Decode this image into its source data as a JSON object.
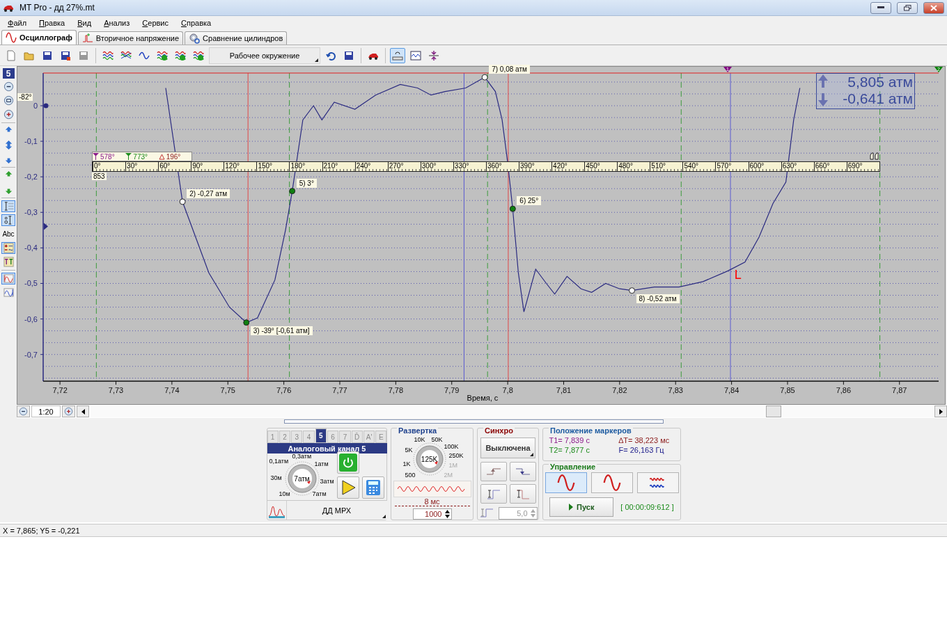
{
  "window": {
    "title": "MT Pro - дд 27%.mt"
  },
  "menu": [
    "Файл",
    "Правка",
    "Вид",
    "Анализ",
    "Сервис",
    "Справка"
  ],
  "tabs": [
    {
      "label": "Осциллограф",
      "selected": true,
      "kind": "sine"
    },
    {
      "label": "Вторичное напряжение",
      "selected": false,
      "kind": "spark"
    },
    {
      "label": "Сравнение цилиндров",
      "selected": false,
      "kind": "gear"
    }
  ],
  "toolbar": {
    "environment": "Рабочее окружение",
    "items": [
      {
        "kind": "new",
        "pressed": false
      },
      {
        "kind": "open",
        "pressed": false
      },
      {
        "kind": "save",
        "pressed": false
      },
      {
        "kind": "save-as",
        "pressed": false
      },
      {
        "kind": "save-copy",
        "pressed": false
      },
      {
        "kind": "sep"
      },
      {
        "kind": "waves-stack",
        "pressed": false
      },
      {
        "kind": "waves-cross",
        "pressed": false
      },
      {
        "kind": "wave-loop",
        "pressed": false
      },
      {
        "kind": "wave-check",
        "pressed": false
      },
      {
        "kind": "wave-one",
        "pressed": false
      },
      {
        "kind": "wave-two",
        "pressed": false
      },
      {
        "kind": "env"
      },
      {
        "kind": "undo",
        "pressed": false
      },
      {
        "kind": "save-screen",
        "pressed": false
      },
      {
        "kind": "sep"
      },
      {
        "kind": "car",
        "pressed": false
      },
      {
        "kind": "sep"
      },
      {
        "kind": "ruler-sync",
        "pressed": true
      },
      {
        "kind": "chart-wave",
        "pressed": false
      },
      {
        "kind": "split",
        "pressed": false
      }
    ]
  },
  "left_tools": [
    {
      "kind": "badge",
      "label": "5"
    },
    {
      "kind": "zoom-out",
      "pressed": false
    },
    {
      "kind": "zoom-fit",
      "pressed": false
    },
    {
      "kind": "zoom-in",
      "pressed": false
    },
    {
      "kind": "sep"
    },
    {
      "kind": "expand-up",
      "pressed": false
    },
    {
      "kind": "expand",
      "pressed": false
    },
    {
      "kind": "expand-down",
      "pressed": false
    },
    {
      "kind": "sep"
    },
    {
      "kind": "arrow-up",
      "pressed": false
    },
    {
      "kind": "arrow-down",
      "pressed": false
    },
    {
      "kind": "sep"
    },
    {
      "kind": "grid",
      "pressed": true
    },
    {
      "kind": "scale",
      "pressed": true
    },
    {
      "kind": "text",
      "label": "Abc",
      "pressed": false
    },
    {
      "kind": "tools",
      "pressed": true
    },
    {
      "kind": "t1t2",
      "pressed": false
    },
    {
      "kind": "sep"
    },
    {
      "kind": "wave-red",
      "pressed": true
    },
    {
      "kind": "wave-blue",
      "pressed": false
    }
  ],
  "chart": {
    "angle_label": "-82°",
    "ruler": {
      "t1": "578°",
      "t2": "773°",
      "delta": "196°",
      "rpm": "853",
      "degrees": [
        "0°",
        "30°",
        "60°",
        "90°",
        "120°",
        "150°",
        "180°",
        "210°",
        "240°",
        "270°",
        "300°",
        "330°",
        "360°",
        "390°",
        "420°",
        "450°",
        "480°",
        "510°",
        "540°",
        "570°",
        "600°",
        "630°",
        "660°",
        "690°"
      ]
    },
    "readout": {
      "max": "5,805 атм",
      "min": "-0,641 атм"
    },
    "handles": [
      {
        "text": "1",
        "color": "#800080"
      },
      {
        "text": "2",
        "color": "#008000"
      }
    ],
    "cursor_letter": {
      "text": "L",
      "color": "#ff0000"
    },
    "chart_data": {
      "type": "line",
      "xlabel": "Время, с",
      "grid": true,
      "xlim": [
        7.717,
        7.877
      ],
      "ylim": [
        -0.775,
        0.092
      ],
      "xticks": [
        {
          "value": 7.72,
          "label": "7,72"
        },
        {
          "value": 7.73,
          "label": "7,73"
        },
        {
          "value": 7.74,
          "label": "7,74"
        },
        {
          "value": 7.75,
          "label": "7,75"
        },
        {
          "value": 7.76,
          "label": "7,76"
        },
        {
          "value": 7.77,
          "label": "7,77"
        },
        {
          "value": 7.78,
          "label": "7,78"
        },
        {
          "value": 7.79,
          "label": "7,79"
        },
        {
          "value": 7.8,
          "label": "7,8"
        },
        {
          "value": 7.81,
          "label": "7,81"
        },
        {
          "value": 7.82,
          "label": "7,82"
        },
        {
          "value": 7.83,
          "label": "7,83"
        },
        {
          "value": 7.84,
          "label": "7,84"
        },
        {
          "value": 7.85,
          "label": "7,85"
        },
        {
          "value": 7.86,
          "label": "7,86"
        },
        {
          "value": 7.87,
          "label": "7,87"
        }
      ],
      "yticks": [
        {
          "value": 0,
          "label": "0"
        },
        {
          "value": -0.1,
          "label": "-0,1"
        },
        {
          "value": -0.2,
          "label": "-0,2"
        },
        {
          "value": -0.3,
          "label": "-0,3"
        },
        {
          "value": -0.4,
          "label": "-0,4"
        },
        {
          "value": -0.5,
          "label": "-0,5"
        },
        {
          "value": -0.6,
          "label": "-0,6"
        },
        {
          "value": -0.7,
          "label": "-0,7"
        }
      ],
      "x": [
        7.7389,
        7.7419,
        7.7466,
        7.7503,
        7.7533,
        7.7553,
        7.7584,
        7.7603,
        7.7615,
        7.7634,
        7.7653,
        7.7668,
        7.769,
        7.7727,
        7.7764,
        7.7808,
        7.7839,
        7.7863,
        7.7888,
        7.7925,
        7.7959,
        7.7978,
        7.799,
        7.8,
        7.8009,
        7.8019,
        7.8029,
        7.805,
        7.8069,
        7.8084,
        7.8106,
        7.8131,
        7.815,
        7.8175,
        7.82,
        7.8222,
        7.8262,
        7.8306,
        7.8349,
        7.8393,
        7.8424,
        7.8449,
        7.8474,
        7.8497,
        7.8511,
        7.8522
      ],
      "series": [
        {
          "color": "#2a2a80",
          "values": [
            0.05,
            -0.27,
            -0.47,
            -0.567,
            -0.61,
            -0.597,
            -0.49,
            -0.35,
            -0.24,
            -0.04,
            0,
            -0.04,
            0.01,
            -0.01,
            0.03,
            0.06,
            0.05,
            0.03,
            0.04,
            0.05,
            0.08,
            0.04,
            -0.04,
            -0.16,
            -0.29,
            -0.47,
            -0.58,
            -0.46,
            -0.5,
            -0.53,
            -0.48,
            -0.515,
            -0.525,
            -0.5,
            -0.515,
            -0.52,
            -0.51,
            -0.51,
            -0.495,
            -0.465,
            -0.44,
            -0.37,
            -0.275,
            -0.215,
            -0.04,
            0.05
          ]
        }
      ],
      "ref_lines": [
        {
          "axis": "x",
          "value": 7.7265,
          "color": "#3c9a3c"
        },
        {
          "axis": "x",
          "value": 7.761,
          "color": "#3c9a3c"
        },
        {
          "axis": "x",
          "value": 7.7964,
          "color": "#3c9a3c"
        },
        {
          "axis": "x",
          "value": 7.831,
          "color": "#3c9a3c"
        },
        {
          "axis": "x",
          "value": 7.8665,
          "color": "#3c9a3c"
        },
        {
          "axis": "x",
          "value": 7.7536,
          "color": "#e04848"
        },
        {
          "axis": "x",
          "value": 7.8001,
          "color": "#e04848"
        },
        {
          "axis": "x",
          "value": 7.7922,
          "color": "#5a5ad0"
        },
        {
          "axis": "x",
          "value": 7.8398,
          "color": "#5a5ad0"
        }
      ],
      "annotations": [
        {
          "text": "2) -0,27 атм",
          "x": 7.7419,
          "y": -0.27
        },
        {
          "text": "3) -39° [-0,61 атм]",
          "x": 7.7533,
          "y": -0.61
        },
        {
          "text": "5) 3°",
          "x": 7.7615,
          "y": -0.24
        },
        {
          "text": "6) 25°",
          "x": 7.8009,
          "y": -0.29
        },
        {
          "text": "7) 0,08 атм",
          "x": 7.7959,
          "y": 0.08
        },
        {
          "text": "8) -0,52 атм",
          "x": 7.8222,
          "y": -0.52
        }
      ]
    }
  },
  "scale": "1:20",
  "channel": {
    "tabs": [
      {
        "label": "1",
        "selected": false
      },
      {
        "label": "2",
        "selected": false
      },
      {
        "label": "3",
        "selected": false
      },
      {
        "label": "4",
        "selected": false
      },
      {
        "label": "5",
        "selected": true
      },
      {
        "label": "6",
        "selected": false
      },
      {
        "label": "7",
        "selected": false
      },
      {
        "label": "D̄",
        "selected": false
      },
      {
        "label": "A'",
        "selected": false
      },
      {
        "label": "E",
        "selected": false
      }
    ],
    "title": "Аналоговый канал 5",
    "power_on": true,
    "dial": {
      "center": "7атм",
      "labels": [
        {
          "text": "0,3атм",
          "disabled": false
        },
        {
          "text": "0,1атм",
          "disabled": false
        },
        {
          "text": "1атм",
          "disabled": false
        },
        {
          "text": "30м",
          "disabled": false
        },
        {
          "text": "3атм",
          "disabled": false
        },
        {
          "text": "10м",
          "disabled": false
        },
        {
          "text": "7атм",
          "disabled": false
        }
      ]
    },
    "sensor": "ДД МРХ"
  },
  "sweep": {
    "title": "Развертка",
    "dial": {
      "center": "125K",
      "labels": [
        {
          "text": "10K",
          "disabled": false
        },
        {
          "text": "50K",
          "disabled": false
        },
        {
          "text": "5K",
          "disabled": false
        },
        {
          "text": "100K",
          "disabled": false
        },
        {
          "text": "250K",
          "disabled": false
        },
        {
          "text": "1K",
          "disabled": false
        },
        {
          "text": "1M",
          "disabled": true
        },
        {
          "text": "500",
          "disabled": false
        },
        {
          "text": "2M",
          "disabled": true
        }
      ]
    },
    "duration": "8 мс",
    "samples": "1000"
  },
  "sync": {
    "title": "Синхро",
    "mode": "Выключена",
    "level": "5,0"
  },
  "markers": {
    "title": "Положение маркеров",
    "items": [
      {
        "text": "T1= 7,839 с",
        "color": "#8a1a8a"
      },
      {
        "text": "∆T= 38,223 мс",
        "color": "#8b1a1a"
      },
      {
        "text": "T2= 7,877 с",
        "color": "#1a8a1a"
      },
      {
        "text": "F= 26,163 Гц",
        "color": "#1a1a8a"
      }
    ]
  },
  "control": {
    "title": "Управление",
    "modes": [
      {
        "kind": "sine",
        "selected": true
      },
      {
        "kind": "sine-framed",
        "selected": false
      },
      {
        "kind": "multi",
        "selected": false
      }
    ],
    "start": "Пуск",
    "timer": "[ 00:00:09:612 ]"
  },
  "status_bar": "X = 7,865; Y5 = -0,221"
}
